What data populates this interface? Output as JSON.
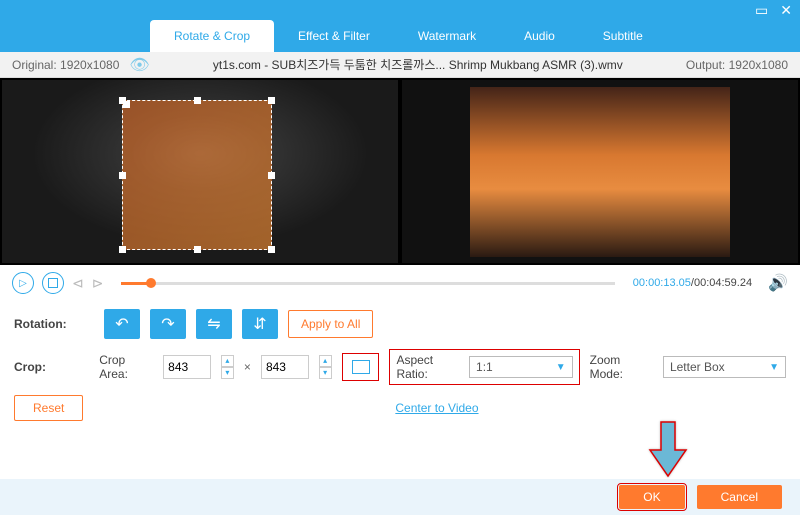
{
  "window": {
    "min_icon": "▭",
    "close_icon": "✕"
  },
  "tabs": [
    {
      "label": "Rotate & Crop",
      "active": true
    },
    {
      "label": "Effect & Filter",
      "active": false
    },
    {
      "label": "Watermark",
      "active": false
    },
    {
      "label": "Audio",
      "active": false
    },
    {
      "label": "Subtitle",
      "active": false
    }
  ],
  "filebar": {
    "original_label": "Original: 1920x1080",
    "filename": "yt1s.com - SUB치즈가득 두툼한 치즈롤까스... Shrimp Mukbang ASMR (3).wmv",
    "output_label": "Output: 1920x1080"
  },
  "playback": {
    "current_time": "00:00:13.05",
    "total_time": "/00:04:59.24"
  },
  "rotation": {
    "label": "Rotation:",
    "apply_label": "Apply to All"
  },
  "crop": {
    "label": "Crop:",
    "area_label": "Crop Area:",
    "width": "843",
    "height": "843",
    "aspect_label": "Aspect Ratio:",
    "aspect_value": "1:1",
    "zoom_label": "Zoom Mode:",
    "zoom_value": "Letter Box",
    "center_label": "Center to Video",
    "reset_label": "Reset"
  },
  "footer": {
    "ok": "OK",
    "cancel": "Cancel"
  }
}
